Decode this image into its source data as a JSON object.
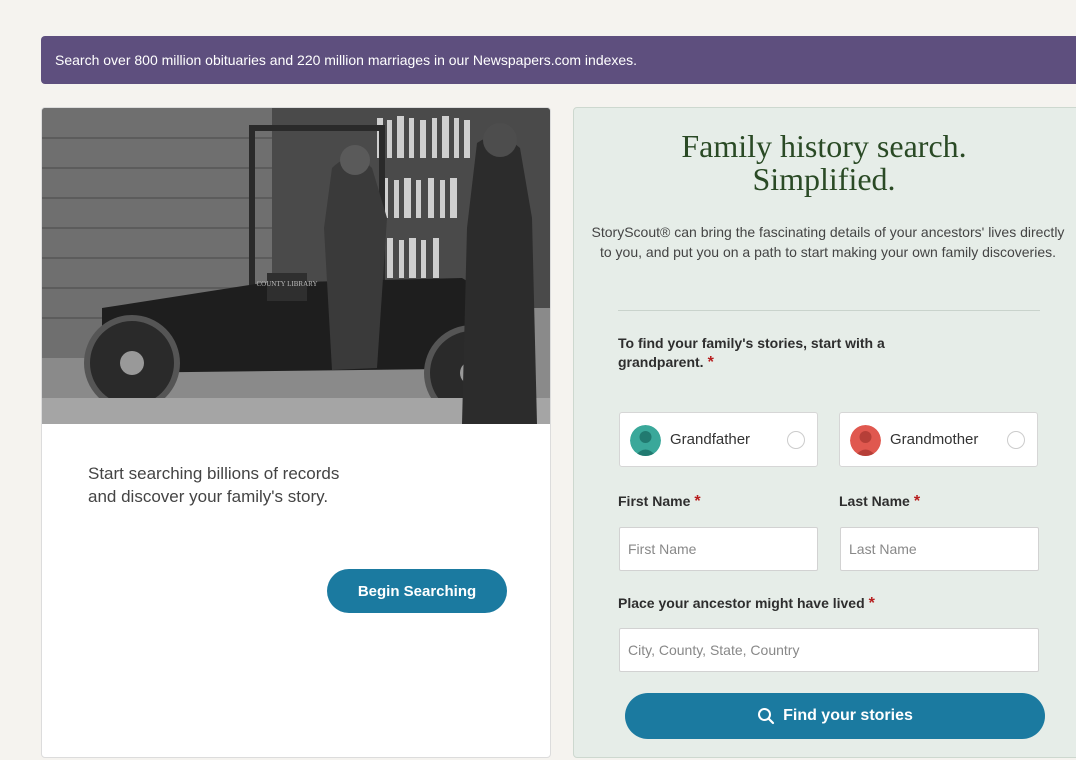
{
  "banner": {
    "text": "Search over 800 million obituaries and 220 million marriages in our Newspapers.com indexes."
  },
  "left_card": {
    "line1": "Start searching billions of records",
    "line2": "and discover your family's story.",
    "button_label": "Begin Searching",
    "photo_sign": "COUNTY LIBRARY"
  },
  "right_card": {
    "heading_line1": "Family history search.",
    "heading_line2": "Simplified.",
    "intro": "StoryScout® can bring the fascinating details of your ancestors' lives directly to you, and put you on a path to start making your own family discoveries.",
    "prompt": "To find your family's stories, start with a grandparent.",
    "grandfather_label": "Grandfather",
    "grandmother_label": "Grandmother",
    "first_name_label": "First Name",
    "last_name_label": "Last Name",
    "first_name_placeholder": "First Name",
    "last_name_placeholder": "Last Name",
    "place_label": "Place your ancestor might have lived",
    "place_placeholder": "City, County, State, Country",
    "find_button_label": "Find your stories",
    "required_mark": "*"
  },
  "colors": {
    "banner": "#5e4f7e",
    "button": "#1b7aa0",
    "panel": "#e6ede8",
    "heading": "#2a4a25",
    "required": "#b71e1e",
    "grandfather_icon": "#3aa89a",
    "grandmother_icon": "#e0584f"
  },
  "icons": [
    "search-icon",
    "grandfather-icon",
    "grandmother-icon",
    "required-star-icon"
  ]
}
